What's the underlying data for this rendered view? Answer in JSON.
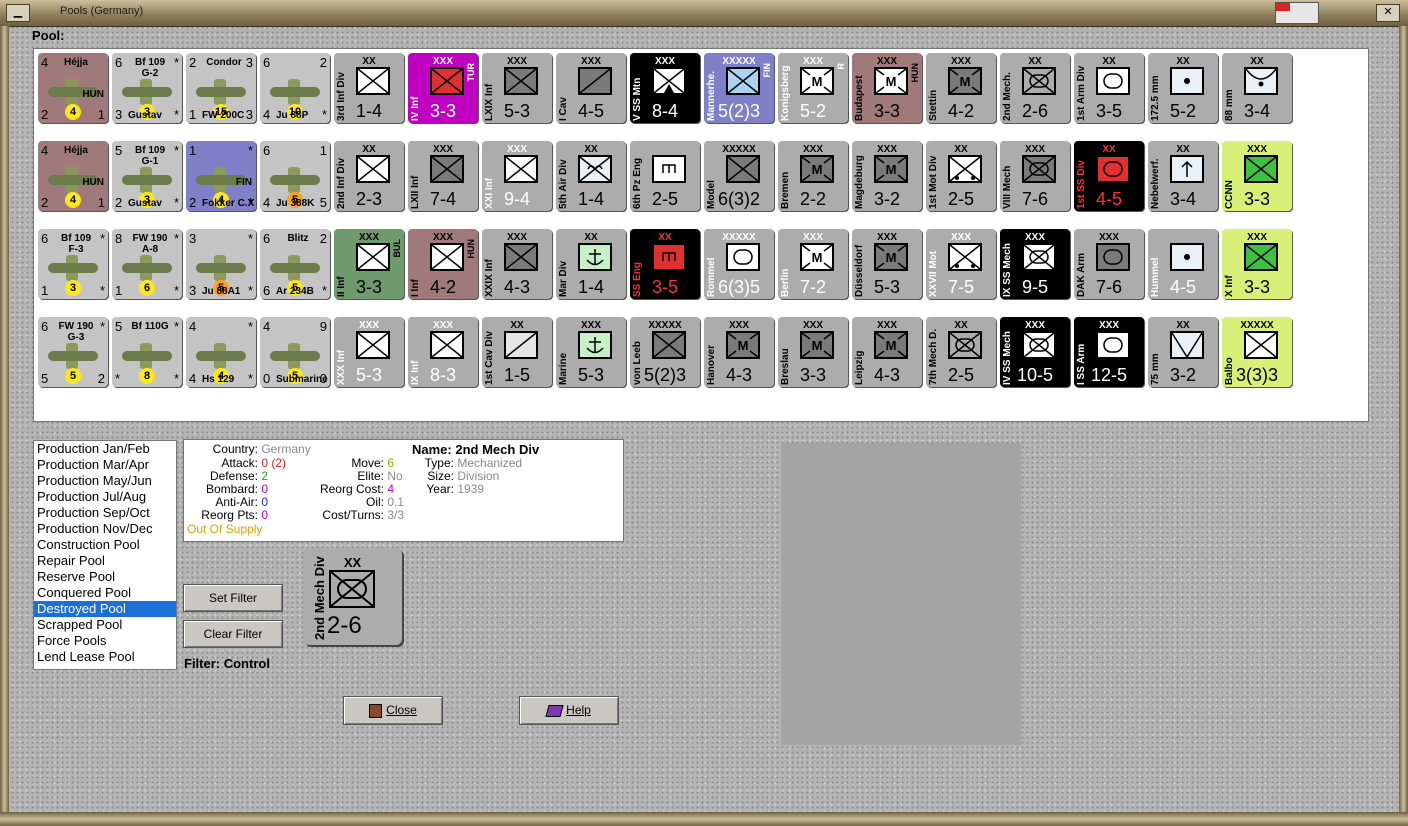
{
  "window": {
    "title": "Pools (Germany)",
    "minimize": "▁",
    "close": "✕"
  },
  "pool_label": "Pool:",
  "rows": [
    [
      {
        "kind": "plane",
        "tl": "4",
        "name": "Héjja",
        "tr": "",
        "bl": "2",
        "br": "1",
        "dot": "4",
        "dot_color": "#ffe81a",
        "nat": "HUN",
        "bg": "#a07a7a",
        "bottom": ""
      },
      {
        "kind": "plane",
        "tl": "6",
        "name": "Bf 109\nG-2",
        "tr": "*",
        "bl": "3",
        "br": "*",
        "dot": "3",
        "dot_color": "#ffe81a",
        "nat": "",
        "bg": "#c4c4c4",
        "bottom": "Gustav"
      },
      {
        "kind": "plane",
        "tl": "2",
        "name": "Condor",
        "tr": "3",
        "bl": "1",
        "br": "3",
        "dot": "15",
        "dot_color": "#ffe81a",
        "nat": "",
        "bg": "#c4c4c4",
        "bottom": "FW 200C"
      },
      {
        "kind": "plane",
        "tl": "6",
        "name": "",
        "tr": "2",
        "bl": "4",
        "br": "*",
        "dot": "10",
        "dot_color": "#ffe81a",
        "nat": "",
        "bg": "#c4c4c4",
        "bottom": "Ju 88P"
      },
      {
        "kind": "unit",
        "ech": "XX",
        "name": "3rd Inf Div",
        "vals": "1-4",
        "bg": "#acacac",
        "fg": "#000",
        "sym": "#ffffff",
        "type": "inf",
        "side": ""
      },
      {
        "kind": "unit",
        "ech": "XXX",
        "name": "IV Inf",
        "vals": "3-3",
        "bg": "#c000c0",
        "fg": "#fff",
        "sym": "#e03030",
        "type": "inf",
        "side": "TUR"
      },
      {
        "kind": "unit",
        "ech": "XXX",
        "name": "LXIX Inf",
        "vals": "5-3",
        "bg": "#acacac",
        "fg": "#000",
        "sym": "#7a7a7a",
        "type": "inf",
        "side": ""
      },
      {
        "kind": "unit",
        "ech": "XXX",
        "name": "I Cav",
        "vals": "4-5",
        "bg": "#acacac",
        "fg": "#000",
        "sym": "#7a7a7a",
        "type": "cav",
        "side": ""
      },
      {
        "kind": "unit",
        "ech": "XXX",
        "name": "V SS Mtn",
        "vals": "8-4",
        "bg": "#000",
        "fg": "#fff",
        "sym": "#ffffff",
        "type": "mtn",
        "side": ""
      },
      {
        "kind": "unit",
        "ech": "XXXXX",
        "name": "Mannerhe.",
        "vals": "5(2)3",
        "bg": "#8080c8",
        "fg": "#fff",
        "sym": "#aad4f0",
        "type": "inf",
        "side": "FIN"
      },
      {
        "kind": "unit",
        "ech": "XXX",
        "name": "Konigsberg",
        "vals": "5-2",
        "bg": "#acacac",
        "fg": "#fff",
        "sym": "#ffffff",
        "type": "mil",
        "side": "R"
      },
      {
        "kind": "unit",
        "ech": "XXX",
        "name": "Budapest",
        "vals": "3-3",
        "bg": "#a07a7a",
        "fg": "#000",
        "sym": "#ffffff",
        "type": "mil",
        "side": "HUN"
      },
      {
        "kind": "unit",
        "ech": "XXX",
        "name": "Stettin",
        "vals": "4-2",
        "bg": "#acacac",
        "fg": "#000",
        "sym": "#7a7a7a",
        "type": "mil",
        "side": ""
      },
      {
        "kind": "unit",
        "ech": "XX",
        "name": "2nd Mech.",
        "vals": "2-6",
        "bg": "#acacac",
        "fg": "#000",
        "sym": "#acacac",
        "type": "mech",
        "side": ""
      },
      {
        "kind": "unit",
        "ech": "XX",
        "name": "1st Arm Div",
        "vals": "3-5",
        "bg": "#acacac",
        "fg": "#000",
        "sym": "#ffffff",
        "type": "arm",
        "side": ""
      },
      {
        "kind": "unit",
        "ech": "XX",
        "name": "172.5 mm",
        "vals": "5-2",
        "bg": "#acacac",
        "fg": "#000",
        "sym": "#e8f0f8",
        "type": "art",
        "side": ""
      },
      {
        "kind": "unit",
        "ech": "XX",
        "name": "88 mm",
        "vals": "3-4",
        "bg": "#acacac",
        "fg": "#000",
        "sym": "#e8f0f8",
        "type": "aa",
        "side": ""
      }
    ],
    [
      {
        "kind": "plane",
        "tl": "4",
        "name": "Héjja",
        "tr": "",
        "bl": "2",
        "br": "1",
        "dot": "4",
        "dot_color": "#ffe81a",
        "nat": "HUN",
        "bg": "#a07a7a",
        "bottom": ""
      },
      {
        "kind": "plane",
        "tl": "5",
        "name": "Bf 109\nG-1",
        "tr": "*",
        "bl": "2",
        "br": "*",
        "dot": "3",
        "dot_color": "#ffe81a",
        "nat": "",
        "bg": "#c4c4c4",
        "bottom": "Gustav"
      },
      {
        "kind": "plane",
        "tl": "1",
        "name": "",
        "tr": "*",
        "bl": "2",
        "br": "*",
        "dot": "4",
        "dot_color": "#ffe81a",
        "nat": "FIN",
        "bg": "#8080c8",
        "bottom": "Fokker C.X"
      },
      {
        "kind": "plane",
        "tl": "6",
        "name": "",
        "tr": "1",
        "bl": "4",
        "br": "5",
        "dot": "5",
        "dot_color": "#ffa020",
        "nat": "",
        "bg": "#c4c4c4",
        "bottom": "Ju 388K"
      },
      {
        "kind": "unit",
        "ech": "XX",
        "name": "2nd Inf Div",
        "vals": "2-3",
        "bg": "#acacac",
        "fg": "#000",
        "sym": "#ffffff",
        "type": "inf",
        "side": ""
      },
      {
        "kind": "unit",
        "ech": "XXX",
        "name": "LXII Inf",
        "vals": "7-4",
        "bg": "#acacac",
        "fg": "#000",
        "sym": "#7a7a7a",
        "type": "inf",
        "side": ""
      },
      {
        "kind": "unit",
        "ech": "XXX",
        "name": "XXI Inf",
        "vals": "9-4",
        "bg": "#acacac",
        "fg": "#fff",
        "sym": "#ffffff",
        "type": "inf",
        "side": ""
      },
      {
        "kind": "unit",
        "ech": "XX",
        "name": "5th Air Div",
        "vals": "1-4",
        "bg": "#acacac",
        "fg": "#000",
        "sym": "#e8f0f8",
        "type": "air",
        "side": ""
      },
      {
        "kind": "unit",
        "ech": "",
        "name": "6th Pz Eng",
        "vals": "2-5",
        "bg": "#acacac",
        "fg": "#000",
        "sym": "#ffffff",
        "type": "eng",
        "side": ""
      },
      {
        "kind": "unit",
        "ech": "XXXXX",
        "name": "Model",
        "vals": "6(3)2",
        "bg": "#acacac",
        "fg": "#000",
        "sym": "#7a7a7a",
        "type": "inf",
        "side": ""
      },
      {
        "kind": "unit",
        "ech": "XXX",
        "name": "Bremen",
        "vals": "2-2",
        "bg": "#acacac",
        "fg": "#000",
        "sym": "#7a7a7a",
        "type": "mil",
        "side": ""
      },
      {
        "kind": "unit",
        "ech": "XXX",
        "name": "Magdeburg",
        "vals": "3-2",
        "bg": "#acacac",
        "fg": "#000",
        "sym": "#7a7a7a",
        "type": "mil",
        "side": ""
      },
      {
        "kind": "unit",
        "ech": "XX",
        "name": "1st Mot Div",
        "vals": "2-5",
        "bg": "#acacac",
        "fg": "#000",
        "sym": "#ffffff",
        "type": "mot",
        "side": ""
      },
      {
        "kind": "unit",
        "ech": "XXX",
        "name": "VIII Mech",
        "vals": "7-6",
        "bg": "#acacac",
        "fg": "#000",
        "sym": "#7a7a7a",
        "type": "mech",
        "side": ""
      },
      {
        "kind": "unit",
        "ech": "XX",
        "name": "1st SS Div",
        "vals": "4-5",
        "bg": "#000",
        "fg": "#ff3030",
        "sym": "#e03030",
        "type": "arm",
        "side": ""
      },
      {
        "kind": "unit",
        "ech": "XX",
        "name": "Nebelwerf.",
        "vals": "3-4",
        "bg": "#acacac",
        "fg": "#000",
        "sym": "#e8f0f8",
        "type": "rkt",
        "side": ""
      },
      {
        "kind": "unit",
        "ech": "XXX",
        "name": "CCNN",
        "vals": "3-3",
        "bg": "#d8f078",
        "fg": "#000",
        "sym": "#40c040",
        "type": "inf",
        "side": ""
      }
    ],
    [
      {
        "kind": "plane",
        "tl": "6",
        "name": "Bf 109\nF-3",
        "tr": "*",
        "bl": "1",
        "br": "*",
        "dot": "3",
        "dot_color": "#ffe81a",
        "nat": "",
        "bg": "#c4c4c4",
        "bottom": ""
      },
      {
        "kind": "plane",
        "tl": "8",
        "name": "FW 190\nA-8",
        "tr": "*",
        "bl": "1",
        "br": "*",
        "dot": "6",
        "dot_color": "#ffe81a",
        "nat": "",
        "bg": "#c4c4c4",
        "bottom": ""
      },
      {
        "kind": "plane",
        "tl": "3",
        "name": "",
        "tr": "*",
        "bl": "3",
        "br": "*",
        "dot": "5",
        "dot_color": "#ffa020",
        "nat": "",
        "bg": "#c4c4c4",
        "bottom": "Ju 88A1"
      },
      {
        "kind": "plane",
        "tl": "6",
        "name": "Blitz",
        "tr": "2",
        "bl": "6",
        "br": "*",
        "dot": "5",
        "dot_color": "#ffe81a",
        "nat": "",
        "bg": "#c4c4c4",
        "bottom": "Ar 234B"
      },
      {
        "kind": "unit",
        "ech": "XXX",
        "name": "II Inf",
        "vals": "3-3",
        "bg": "#6e9a6e",
        "fg": "#000",
        "sym": "#ffffff",
        "type": "inf",
        "side": "BUL"
      },
      {
        "kind": "unit",
        "ech": "XXX",
        "name": "I Inf",
        "vals": "4-2",
        "bg": "#a07a7a",
        "fg": "#000",
        "sym": "#ffffff",
        "type": "inf",
        "side": "HUN"
      },
      {
        "kind": "unit",
        "ech": "XXX",
        "name": "XXIX Inf",
        "vals": "4-3",
        "bg": "#acacac",
        "fg": "#000",
        "sym": "#7a7a7a",
        "type": "inf",
        "side": ""
      },
      {
        "kind": "unit",
        "ech": "XX",
        "name": "Mar Div",
        "vals": "1-4",
        "bg": "#acacac",
        "fg": "#000",
        "sym": "#c8f0c8",
        "type": "mar",
        "side": ""
      },
      {
        "kind": "unit",
        "ech": "XX",
        "name": "SS Eng",
        "vals": "3-5",
        "bg": "#000",
        "fg": "#ff3030",
        "sym": "#e03030",
        "type": "eng",
        "side": ""
      },
      {
        "kind": "unit",
        "ech": "XXXXX",
        "name": "Rommel",
        "vals": "6(3)5",
        "bg": "#acacac",
        "fg": "#fff",
        "sym": "#ffffff",
        "type": "arm",
        "side": ""
      },
      {
        "kind": "unit",
        "ech": "XXX",
        "name": "Berlin",
        "vals": "7-2",
        "bg": "#acacac",
        "fg": "#fff",
        "sym": "#ffffff",
        "type": "mil",
        "side": ""
      },
      {
        "kind": "unit",
        "ech": "XXX",
        "name": "Düsseldorf",
        "vals": "5-3",
        "bg": "#acacac",
        "fg": "#000",
        "sym": "#7a7a7a",
        "type": "mil",
        "side": ""
      },
      {
        "kind": "unit",
        "ech": "XXX",
        "name": "XXVII Mot",
        "vals": "7-5",
        "bg": "#acacac",
        "fg": "#fff",
        "sym": "#ffffff",
        "type": "mot",
        "side": ""
      },
      {
        "kind": "unit",
        "ech": "XXX",
        "name": "IX SS Mech",
        "vals": "9-5",
        "bg": "#000",
        "fg": "#fff",
        "sym": "#ffffff",
        "type": "mech",
        "side": ""
      },
      {
        "kind": "unit",
        "ech": "XXX",
        "name": "DAK Arm",
        "vals": "7-6",
        "bg": "#acacac",
        "fg": "#000",
        "sym": "#7a7a7a",
        "type": "arm",
        "side": ""
      },
      {
        "kind": "unit",
        "ech": "",
        "name": "Hummel",
        "vals": "4-5",
        "bg": "#acacac",
        "fg": "#fff",
        "sym": "#e8f0f8",
        "type": "art",
        "side": ""
      },
      {
        "kind": "unit",
        "ech": "XXX",
        "name": "X Inf",
        "vals": "3-3",
        "bg": "#d8f078",
        "fg": "#000",
        "sym": "#40c040",
        "type": "inf",
        "side": ""
      }
    ],
    [
      {
        "kind": "plane",
        "tl": "6",
        "name": "FW 190\nG-3",
        "tr": "*",
        "bl": "5",
        "br": "2",
        "dot": "5",
        "dot_color": "#ffe81a",
        "nat": "",
        "bg": "#c4c4c4",
        "bottom": ""
      },
      {
        "kind": "plane",
        "tl": "5",
        "name": "Bf 110G",
        "tr": "*",
        "bl": "*",
        "br": "*",
        "dot": "8",
        "dot_color": "#ffe81a",
        "nat": "",
        "bg": "#c4c4c4",
        "bottom": ""
      },
      {
        "kind": "plane",
        "tl": "4",
        "name": "",
        "tr": "*",
        "bl": "4",
        "br": "*",
        "dot": "4",
        "dot_color": "#ffe81a",
        "nat": "",
        "bg": "#c4c4c4",
        "bottom": "Hs 129"
      },
      {
        "kind": "plane",
        "tl": "4",
        "name": "",
        "tr": "9",
        "bl": "0",
        "br": "0",
        "dot": "5",
        "dot_color": "#ffe81a",
        "nat": "",
        "bg": "#c4c4c4",
        "bottom": "Submarine"
      },
      {
        "kind": "unit",
        "ech": "XXX",
        "name": "XXX Inf",
        "vals": "5-3",
        "bg": "#acacac",
        "fg": "#fff",
        "sym": "#ffffff",
        "type": "inf",
        "side": ""
      },
      {
        "kind": "unit",
        "ech": "XXX",
        "name": "IX Inf",
        "vals": "8-3",
        "bg": "#acacac",
        "fg": "#fff",
        "sym": "#ffffff",
        "type": "inf",
        "side": ""
      },
      {
        "kind": "unit",
        "ech": "XX",
        "name": "1st Cav Div",
        "vals": "1-5",
        "bg": "#acacac",
        "fg": "#000",
        "sym": "#e6e6e6",
        "type": "cav",
        "side": ""
      },
      {
        "kind": "unit",
        "ech": "XXX",
        "name": "Marine",
        "vals": "5-3",
        "bg": "#acacac",
        "fg": "#000",
        "sym": "#c8f0c8",
        "type": "mar",
        "side": ""
      },
      {
        "kind": "unit",
        "ech": "XXXXX",
        "name": "von Leeb",
        "vals": "5(2)3",
        "bg": "#acacac",
        "fg": "#000",
        "sym": "#7a7a7a",
        "type": "inf",
        "side": ""
      },
      {
        "kind": "unit",
        "ech": "XXX",
        "name": "Hanover",
        "vals": "4-3",
        "bg": "#acacac",
        "fg": "#000",
        "sym": "#7a7a7a",
        "type": "mil",
        "side": ""
      },
      {
        "kind": "unit",
        "ech": "XXX",
        "name": "Breslau",
        "vals": "3-3",
        "bg": "#acacac",
        "fg": "#000",
        "sym": "#7a7a7a",
        "type": "mil",
        "side": ""
      },
      {
        "kind": "unit",
        "ech": "XXX",
        "name": "Leipzig",
        "vals": "4-3",
        "bg": "#acacac",
        "fg": "#000",
        "sym": "#7a7a7a",
        "type": "mil",
        "side": ""
      },
      {
        "kind": "unit",
        "ech": "XX",
        "name": "7th Mech D.",
        "vals": "2-5",
        "bg": "#acacac",
        "fg": "#000",
        "sym": "#acacac",
        "type": "mech",
        "side": ""
      },
      {
        "kind": "unit",
        "ech": "XXX",
        "name": "IV SS Mech",
        "vals": "10-5",
        "bg": "#000",
        "fg": "#fff",
        "sym": "#ffffff",
        "type": "mech",
        "side": ""
      },
      {
        "kind": "unit",
        "ech": "XXX",
        "name": "I SS Arm",
        "vals": "12-5",
        "bg": "#000",
        "fg": "#fff",
        "sym": "#ffffff",
        "type": "arm",
        "side": ""
      },
      {
        "kind": "unit",
        "ech": "XX",
        "name": "75 mm",
        "vals": "3-2",
        "bg": "#acacac",
        "fg": "#000",
        "sym": "#e8f0f8",
        "type": "at",
        "side": ""
      },
      {
        "kind": "unit",
        "ech": "XXXXX",
        "name": "Balbo",
        "vals": "3(3)3",
        "bg": "#d8f078",
        "fg": "#000",
        "sym": "#ffffff",
        "type": "inf",
        "side": ""
      }
    ]
  ],
  "pool_list": [
    {
      "label": "Production Jan/Feb",
      "selected": false
    },
    {
      "label": "Production Mar/Apr",
      "selected": false
    },
    {
      "label": "Production May/Jun",
      "selected": false
    },
    {
      "label": "Production Jul/Aug",
      "selected": false
    },
    {
      "label": "Production Sep/Oct",
      "selected": false
    },
    {
      "label": "Production Nov/Dec",
      "selected": false
    },
    {
      "label": "Construction Pool",
      "selected": false
    },
    {
      "label": "Repair Pool",
      "selected": false
    },
    {
      "label": "Reserve Pool",
      "selected": false
    },
    {
      "label": "Conquered Pool",
      "selected": false
    },
    {
      "label": "Destroyed Pool",
      "selected": true
    },
    {
      "label": "Scrapped Pool",
      "selected": false
    },
    {
      "label": "Force Pools",
      "selected": false
    },
    {
      "label": "Lend Lease Pool",
      "selected": false
    }
  ],
  "info": {
    "country_label": "Country:",
    "country": "Germany",
    "attack_label": "Attack:",
    "attack": "0 (2)",
    "defense_label": "Defense:",
    "defense": "2",
    "bombard_label": "Bombard:",
    "bombard": "0",
    "antiair_label": "Anti-Air:",
    "antiair": "0",
    "reorg_label": "Reorg Pts:",
    "reorg": "0",
    "supply": "Out Of Supply",
    "move_label": "Move:",
    "move": "6",
    "elite_label": "Elite:",
    "elite": "No",
    "reorg_cost_label": "Reorg Cost:",
    "reorg_cost": "4",
    "oil_label": "Oil:",
    "oil": "0.1",
    "cost_label": "Cost/Turns:",
    "cost": "3/3",
    "name_label": "Name:",
    "name": "2nd Mech Div",
    "type_label": "Type:",
    "type": "Mechanized",
    "size_label": "Size:",
    "size": "Division",
    "year_label": "Year:",
    "year": "1939"
  },
  "buttons": {
    "set_filter": "Set Filter",
    "clear_filter": "Clear Filter",
    "close": "Close",
    "help": "Help"
  },
  "filter_label": "Filter: Control",
  "selected_counter": {
    "ech": "XX",
    "name": "2nd Mech Div",
    "vals": "2-6"
  },
  "colors": {
    "selection": "#1a6fd8",
    "attack": "#e02020",
    "defense": "#20a020",
    "bombard": "#c000c0",
    "antiair": "#2020e0",
    "reorg": "#c000c0",
    "supply": "#e0a000",
    "move": "#a0a000",
    "reorg_cost": "#c000c0"
  }
}
